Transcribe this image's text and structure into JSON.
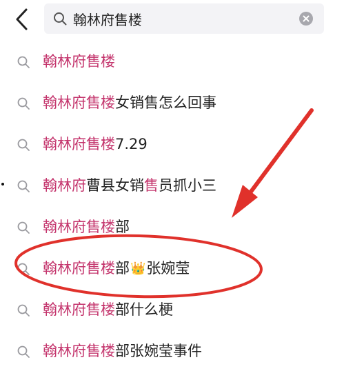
{
  "header": {
    "back_icon": "chevron-left-icon",
    "search_query": "翰林府售楼",
    "search_icon": "search-icon",
    "clear_icon": "clear-circle-icon"
  },
  "suggestions": [
    {
      "prefix": "翰林府售楼",
      "suffix": "",
      "suffix2": ""
    },
    {
      "prefix": "翰林府售楼",
      "suffix": "女销售怎么回事",
      "suffix2": ""
    },
    {
      "prefix": "翰林府售楼",
      "suffix": "7.29",
      "suffix2": ""
    },
    {
      "prefix": "翰林府",
      "suffix": "曹县女销",
      "hl2": "售",
      "suffix2": "员抓小三"
    },
    {
      "prefix": "翰林府售楼",
      "suffix": "部",
      "suffix2": ""
    },
    {
      "prefix": "翰林府售楼",
      "suffix": "部",
      "crown": "👑",
      "suffix2": "张婉莹"
    },
    {
      "prefix": "翰林府售楼",
      "suffix": "部什么梗",
      "suffix2": ""
    },
    {
      "prefix": "翰林府售楼",
      "suffix": "部张婉莹事件",
      "suffix2": ""
    }
  ],
  "colors": {
    "highlight": "#c4356d",
    "annotation": "#e0312b",
    "text": "#222222",
    "icon": "#9a9a9f"
  }
}
